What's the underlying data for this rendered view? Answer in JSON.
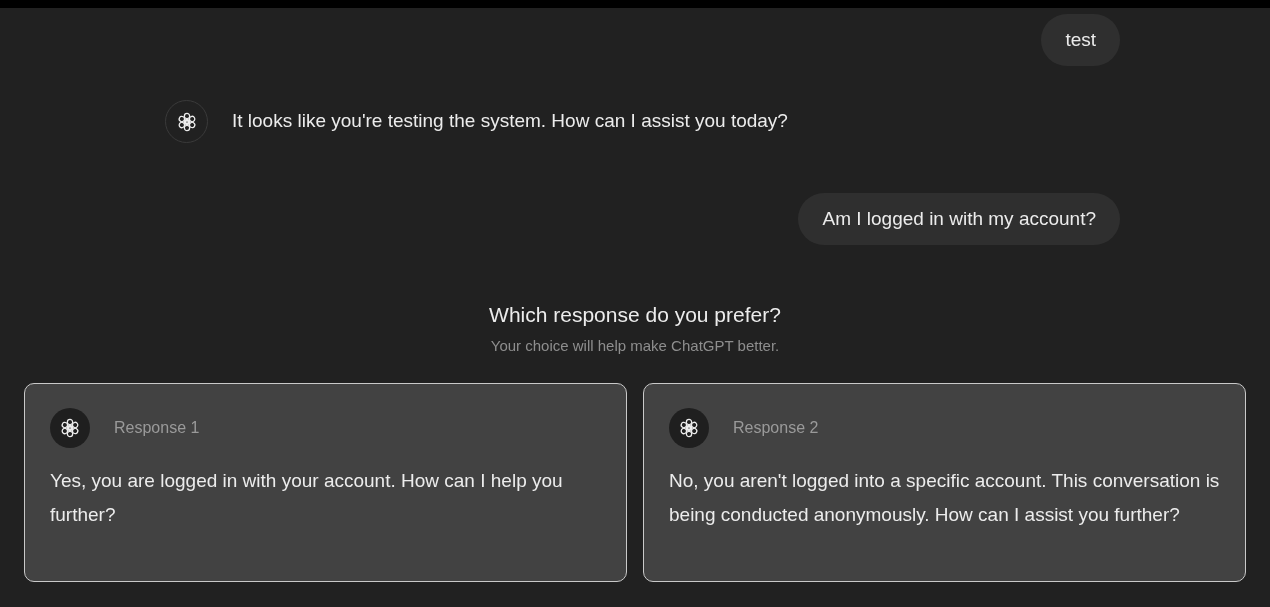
{
  "messages": [
    {
      "kind": "user",
      "text": "test"
    },
    {
      "kind": "assistant",
      "text": "It looks like you're testing the system. How can I assist you today?"
    },
    {
      "kind": "user",
      "text": "Am I logged in with my account?"
    }
  ],
  "comparison": {
    "title": "Which response do you prefer?",
    "subtitle": "Your choice will help make ChatGPT better.",
    "responses": [
      {
        "label": "Response 1",
        "text": "Yes, you are logged in with your account. How can I help you further?"
      },
      {
        "label": "Response 2",
        "text": "No, you aren't logged into a specific account. This conversation is being conducted anonymously. How can I assist you further?"
      }
    ]
  }
}
